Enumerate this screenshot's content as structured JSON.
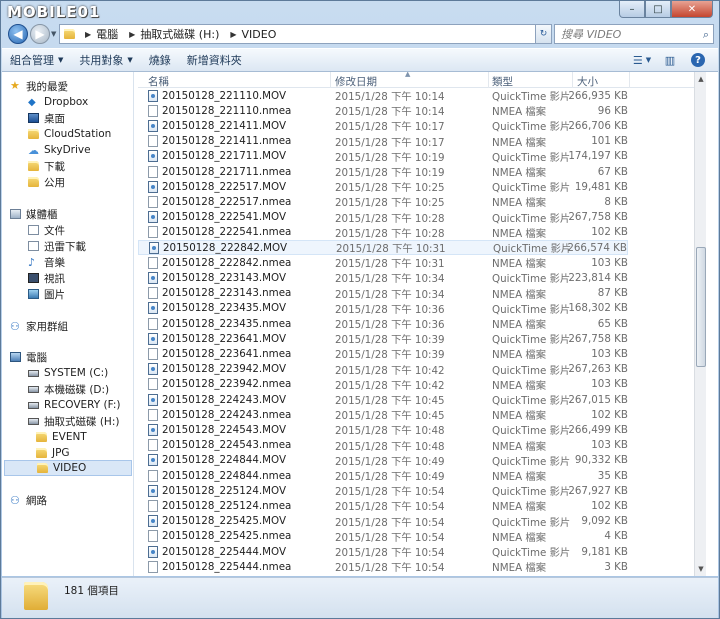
{
  "window": {
    "wordmark": "MOBILE01",
    "buttons": {
      "minimize": "–",
      "maximize": "□",
      "close": "✕"
    }
  },
  "address": {
    "crumbs": [
      "電腦",
      "抽取式磁碟 (H:)",
      "VIDEO"
    ],
    "search_placeholder": "搜尋 VIDEO"
  },
  "toolbar": {
    "organize": "組合管理",
    "share": "共用對象",
    "burn": "燒錄",
    "new_folder": "新增資料夾"
  },
  "sidebar": {
    "favorites": "我的最愛",
    "fav_items": [
      "Dropbox",
      "桌面",
      "CloudStation",
      "SkyDrive",
      "下載",
      "公用"
    ],
    "libraries": "媒體櫃",
    "lib_items": [
      "文件",
      "迅雷下載",
      "音樂",
      "視訊",
      "圖片"
    ],
    "homegroup": "家用群組",
    "computer": "電腦",
    "drives": [
      "SYSTEM (C:)",
      "本機磁碟 (D:)",
      "RECOVERY (F:)",
      "抽取式磁碟 (H:)"
    ],
    "subfolders": [
      "EVENT",
      "JPG",
      "VIDEO"
    ],
    "network": "網路"
  },
  "columns": {
    "name": "名稱",
    "date": "修改日期",
    "type": "類型",
    "size": "大小"
  },
  "files": [
    {
      "name": "20150128_221110.MOV",
      "date": "2015/1/28 下午 10:14",
      "type": "QuickTime 影片",
      "size": "266,935 KB",
      "kind": "mov"
    },
    {
      "name": "20150128_221110.nmea",
      "date": "2015/1/28 下午 10:14",
      "type": "NMEA 檔案",
      "size": "96 KB",
      "kind": "nmea"
    },
    {
      "name": "20150128_221411.MOV",
      "date": "2015/1/28 下午 10:17",
      "type": "QuickTime 影片",
      "size": "266,706 KB",
      "kind": "mov"
    },
    {
      "name": "20150128_221411.nmea",
      "date": "2015/1/28 下午 10:17",
      "type": "NMEA 檔案",
      "size": "101 KB",
      "kind": "nmea"
    },
    {
      "name": "20150128_221711.MOV",
      "date": "2015/1/28 下午 10:19",
      "type": "QuickTime 影片",
      "size": "174,197 KB",
      "kind": "mov"
    },
    {
      "name": "20150128_221711.nmea",
      "date": "2015/1/28 下午 10:19",
      "type": "NMEA 檔案",
      "size": "67 KB",
      "kind": "nmea"
    },
    {
      "name": "20150128_222517.MOV",
      "date": "2015/1/28 下午 10:25",
      "type": "QuickTime 影片",
      "size": "19,481 KB",
      "kind": "mov"
    },
    {
      "name": "20150128_222517.nmea",
      "date": "2015/1/28 下午 10:25",
      "type": "NMEA 檔案",
      "size": "8 KB",
      "kind": "nmea"
    },
    {
      "name": "20150128_222541.MOV",
      "date": "2015/1/28 下午 10:28",
      "type": "QuickTime 影片",
      "size": "267,758 KB",
      "kind": "mov"
    },
    {
      "name": "20150128_222541.nmea",
      "date": "2015/1/28 下午 10:28",
      "type": "NMEA 檔案",
      "size": "102 KB",
      "kind": "nmea"
    },
    {
      "name": "20150128_222842.MOV",
      "date": "2015/1/28 下午 10:31",
      "type": "QuickTime 影片",
      "size": "266,574 KB",
      "kind": "mov"
    },
    {
      "name": "20150128_222842.nmea",
      "date": "2015/1/28 下午 10:31",
      "type": "NMEA 檔案",
      "size": "103 KB",
      "kind": "nmea"
    },
    {
      "name": "20150128_223143.MOV",
      "date": "2015/1/28 下午 10:34",
      "type": "QuickTime 影片",
      "size": "223,814 KB",
      "kind": "mov"
    },
    {
      "name": "20150128_223143.nmea",
      "date": "2015/1/28 下午 10:34",
      "type": "NMEA 檔案",
      "size": "87 KB",
      "kind": "nmea"
    },
    {
      "name": "20150128_223435.MOV",
      "date": "2015/1/28 下午 10:36",
      "type": "QuickTime 影片",
      "size": "168,302 KB",
      "kind": "mov"
    },
    {
      "name": "20150128_223435.nmea",
      "date": "2015/1/28 下午 10:36",
      "type": "NMEA 檔案",
      "size": "65 KB",
      "kind": "nmea"
    },
    {
      "name": "20150128_223641.MOV",
      "date": "2015/1/28 下午 10:39",
      "type": "QuickTime 影片",
      "size": "267,758 KB",
      "kind": "mov"
    },
    {
      "name": "20150128_223641.nmea",
      "date": "2015/1/28 下午 10:39",
      "type": "NMEA 檔案",
      "size": "103 KB",
      "kind": "nmea"
    },
    {
      "name": "20150128_223942.MOV",
      "date": "2015/1/28 下午 10:42",
      "type": "QuickTime 影片",
      "size": "267,263 KB",
      "kind": "mov"
    },
    {
      "name": "20150128_223942.nmea",
      "date": "2015/1/28 下午 10:42",
      "type": "NMEA 檔案",
      "size": "103 KB",
      "kind": "nmea"
    },
    {
      "name": "20150128_224243.MOV",
      "date": "2015/1/28 下午 10:45",
      "type": "QuickTime 影片",
      "size": "267,015 KB",
      "kind": "mov"
    },
    {
      "name": "20150128_224243.nmea",
      "date": "2015/1/28 下午 10:45",
      "type": "NMEA 檔案",
      "size": "102 KB",
      "kind": "nmea"
    },
    {
      "name": "20150128_224543.MOV",
      "date": "2015/1/28 下午 10:48",
      "type": "QuickTime 影片",
      "size": "266,499 KB",
      "kind": "mov"
    },
    {
      "name": "20150128_224543.nmea",
      "date": "2015/1/28 下午 10:48",
      "type": "NMEA 檔案",
      "size": "103 KB",
      "kind": "nmea"
    },
    {
      "name": "20150128_224844.MOV",
      "date": "2015/1/28 下午 10:49",
      "type": "QuickTime 影片",
      "size": "90,332 KB",
      "kind": "mov"
    },
    {
      "name": "20150128_224844.nmea",
      "date": "2015/1/28 下午 10:49",
      "type": "NMEA 檔案",
      "size": "35 KB",
      "kind": "nmea"
    },
    {
      "name": "20150128_225124.MOV",
      "date": "2015/1/28 下午 10:54",
      "type": "QuickTime 影片",
      "size": "267,927 KB",
      "kind": "mov"
    },
    {
      "name": "20150128_225124.nmea",
      "date": "2015/1/28 下午 10:54",
      "type": "NMEA 檔案",
      "size": "102 KB",
      "kind": "nmea"
    },
    {
      "name": "20150128_225425.MOV",
      "date": "2015/1/28 下午 10:54",
      "type": "QuickTime 影片",
      "size": "9,092 KB",
      "kind": "mov"
    },
    {
      "name": "20150128_225425.nmea",
      "date": "2015/1/28 下午 10:54",
      "type": "NMEA 檔案",
      "size": "4 KB",
      "kind": "nmea"
    },
    {
      "name": "20150128_225444.MOV",
      "date": "2015/1/28 下午 10:54",
      "type": "QuickTime 影片",
      "size": "9,181 KB",
      "kind": "mov"
    },
    {
      "name": "20150128_225444.nmea",
      "date": "2015/1/28 下午 10:54",
      "type": "NMEA 檔案",
      "size": "3 KB",
      "kind": "nmea"
    }
  ],
  "status": {
    "count": "181 個項目"
  },
  "colors": {
    "accent": "#2867b2",
    "selection": "#d9e7f7",
    "chrome": "#a9c4e3"
  }
}
